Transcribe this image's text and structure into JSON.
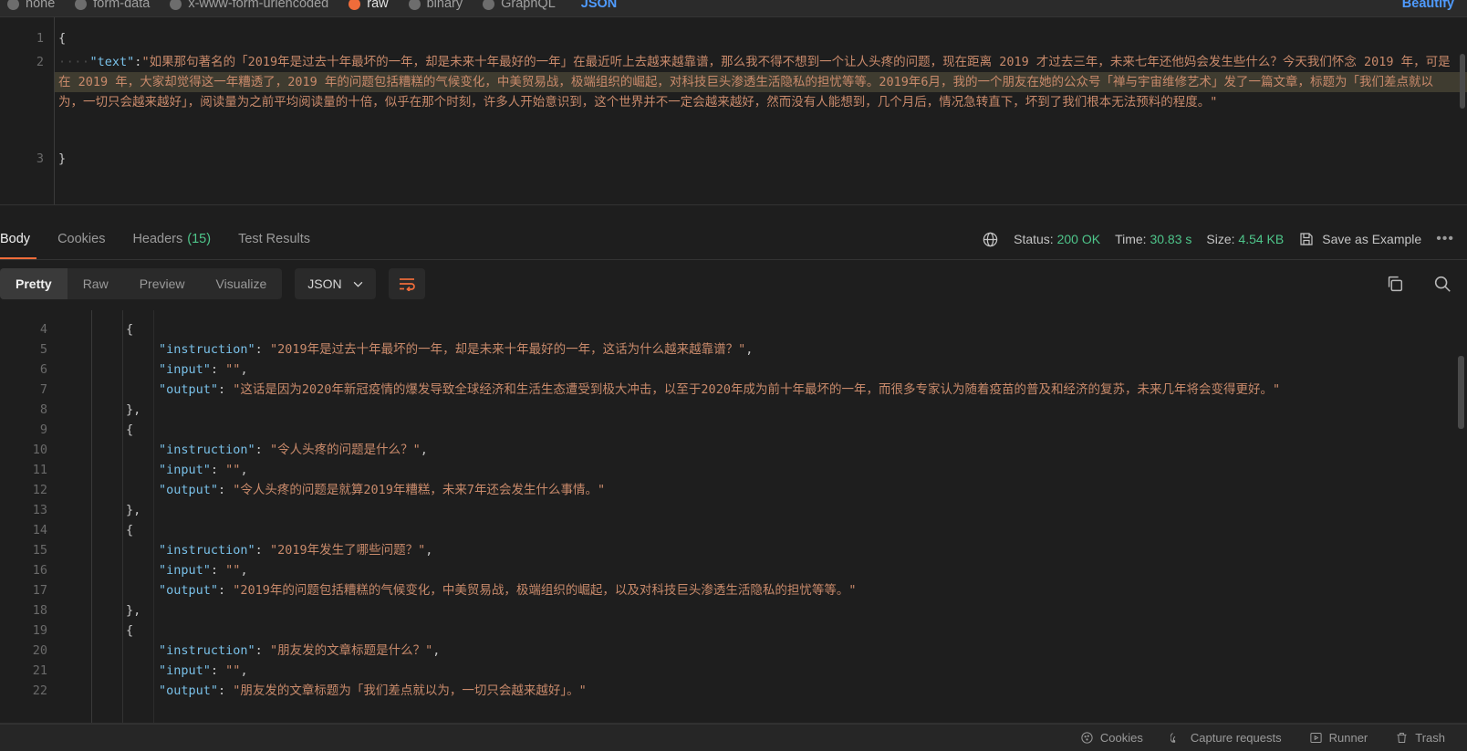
{
  "request_body_bar": {
    "options": [
      {
        "label": "none",
        "selected": false
      },
      {
        "label": "form-data",
        "selected": false
      },
      {
        "label": "x-www-form-urlencoded",
        "selected": false
      },
      {
        "label": "raw",
        "selected": true
      },
      {
        "label": "binary",
        "selected": false
      },
      {
        "label": "GraphQL",
        "selected": false
      }
    ],
    "format_label": "JSON",
    "beautify_label": "Beautify"
  },
  "request_editor": {
    "lines": [
      {
        "number": "1",
        "content": "{"
      },
      {
        "number": "2",
        "content": "\"text\":\"...\""
      },
      {
        "number": "3",
        "content": "}"
      }
    ],
    "key_text": "\"text\"",
    "colon": ":",
    "text_value": "\"如果那句著名的「2019年是过去十年最坏的一年，却是未来十年最好的一年」在最近听上去越来越靠谱，那么我不得不想到一个让人头疼的问题，现在距离 2019 才过去三年，未来七年还他妈会发生些什么？今天我们怀念 2019 年，可是在 2019 年，大家却觉得这一年糟透了，2019 年的问题包括糟糕的气候变化，中美贸易战，极端组织的崛起，对科技巨头渗透生活隐私的担忧等等。2019年6月，我的一个朋友在她的公众号「禅与宇宙维修艺术」发了一篇文章，标题为「我们差点就以为，一切只会越来越好」，阅读量为之前平均阅读量的十倍，似乎在那个时刻，许多人开始意识到，这个世界并不一定会越来越好，然而没有人能想到，几个月后，情况急转直下，坏到了我们根本无法预料的程度。\""
  },
  "response_tabs": {
    "items": [
      {
        "label": "Body",
        "active": true,
        "count": null
      },
      {
        "label": "Cookies",
        "active": false,
        "count": null
      },
      {
        "label": "Headers",
        "active": false,
        "count": "(15)"
      },
      {
        "label": "Test Results",
        "active": false,
        "count": null
      }
    ]
  },
  "response_meta": {
    "status_label": "Status:",
    "status_value": "200 OK",
    "time_label": "Time:",
    "time_value": "30.83 s",
    "size_label": "Size:",
    "size_value": "4.54 KB",
    "save_example_label": "Save as Example",
    "more_label": "•••"
  },
  "view_toolbar": {
    "modes": [
      {
        "label": "Pretty",
        "active": true
      },
      {
        "label": "Raw",
        "active": false
      },
      {
        "label": "Preview",
        "active": false
      },
      {
        "label": "Visualize",
        "active": false
      }
    ],
    "format_selected": "JSON"
  },
  "response_body": {
    "lines": [
      {
        "n": "4",
        "indent": 1,
        "type": "brace",
        "text": "{"
      },
      {
        "n": "5",
        "indent": 2,
        "type": "pair",
        "key": "\"instruction\"",
        "sep": ": ",
        "value": "\"2019年是过去十年最坏的一年，却是未来十年最好的一年，这话为什么越来越靠谱？\"",
        "trail": ","
      },
      {
        "n": "6",
        "indent": 2,
        "type": "pair",
        "key": "\"input\"",
        "sep": ": ",
        "value": "\"\"",
        "trail": ","
      },
      {
        "n": "7",
        "indent": 2,
        "type": "pair",
        "key": "\"output\"",
        "sep": ": ",
        "value": "\"这话是因为2020年新冠疫情的爆发导致全球经济和生活生态遭受到极大冲击，以至于2020年成为前十年最坏的一年，而很多专家认为随着疫苗的普及和经济的复苏，未来几年将会变得更好。\"",
        "trail": ""
      },
      {
        "n": "8",
        "indent": 1,
        "type": "brace",
        "text": "},"
      },
      {
        "n": "9",
        "indent": 1,
        "type": "brace",
        "text": "{"
      },
      {
        "n": "10",
        "indent": 2,
        "type": "pair",
        "key": "\"instruction\"",
        "sep": ": ",
        "value": "\"令人头疼的问题是什么？\"",
        "trail": ","
      },
      {
        "n": "11",
        "indent": 2,
        "type": "pair",
        "key": "\"input\"",
        "sep": ": ",
        "value": "\"\"",
        "trail": ","
      },
      {
        "n": "12",
        "indent": 2,
        "type": "pair",
        "key": "\"output\"",
        "sep": ": ",
        "value": "\"令人头疼的问题是就算2019年糟糕，未来7年还会发生什么事情。\"",
        "trail": ""
      },
      {
        "n": "13",
        "indent": 1,
        "type": "brace",
        "text": "},"
      },
      {
        "n": "14",
        "indent": 1,
        "type": "brace",
        "text": "{"
      },
      {
        "n": "15",
        "indent": 2,
        "type": "pair",
        "key": "\"instruction\"",
        "sep": ": ",
        "value": "\"2019年发生了哪些问题？\"",
        "trail": ","
      },
      {
        "n": "16",
        "indent": 2,
        "type": "pair",
        "key": "\"input\"",
        "sep": ": ",
        "value": "\"\"",
        "trail": ","
      },
      {
        "n": "17",
        "indent": 2,
        "type": "pair",
        "key": "\"output\"",
        "sep": ": ",
        "value": "\"2019年的问题包括糟糕的气候变化，中美贸易战，极端组织的崛起，以及对科技巨头渗透生活隐私的担忧等等。\"",
        "trail": ""
      },
      {
        "n": "18",
        "indent": 1,
        "type": "brace",
        "text": "},"
      },
      {
        "n": "19",
        "indent": 1,
        "type": "brace",
        "text": "{"
      },
      {
        "n": "20",
        "indent": 2,
        "type": "pair",
        "key": "\"instruction\"",
        "sep": ": ",
        "value": "\"朋友发的文章标题是什么？\"",
        "trail": ","
      },
      {
        "n": "21",
        "indent": 2,
        "type": "pair",
        "key": "\"input\"",
        "sep": ": ",
        "value": "\"\"",
        "trail": ","
      },
      {
        "n": "22",
        "indent": 2,
        "type": "pair",
        "key": "\"output\"",
        "sep": ": ",
        "value": "\"朋友发的文章标题为「我们差点就以为，一切只会越来越好」。\"",
        "trail": ""
      }
    ]
  },
  "status_bar": {
    "items": [
      {
        "label": "Cookies",
        "icon": "cookie-icon"
      },
      {
        "label": "Capture requests",
        "icon": "satellite-icon"
      },
      {
        "label": "Runner",
        "icon": "runner-icon"
      },
      {
        "label": "Trash",
        "icon": "trash-icon"
      }
    ]
  },
  "colors": {
    "accent": "#f06c3a",
    "link": "#4f9bff",
    "success": "#4ec58a",
    "json_key": "#79c0e8",
    "json_string": "#c98a6b",
    "background": "#1e1e1e"
  }
}
